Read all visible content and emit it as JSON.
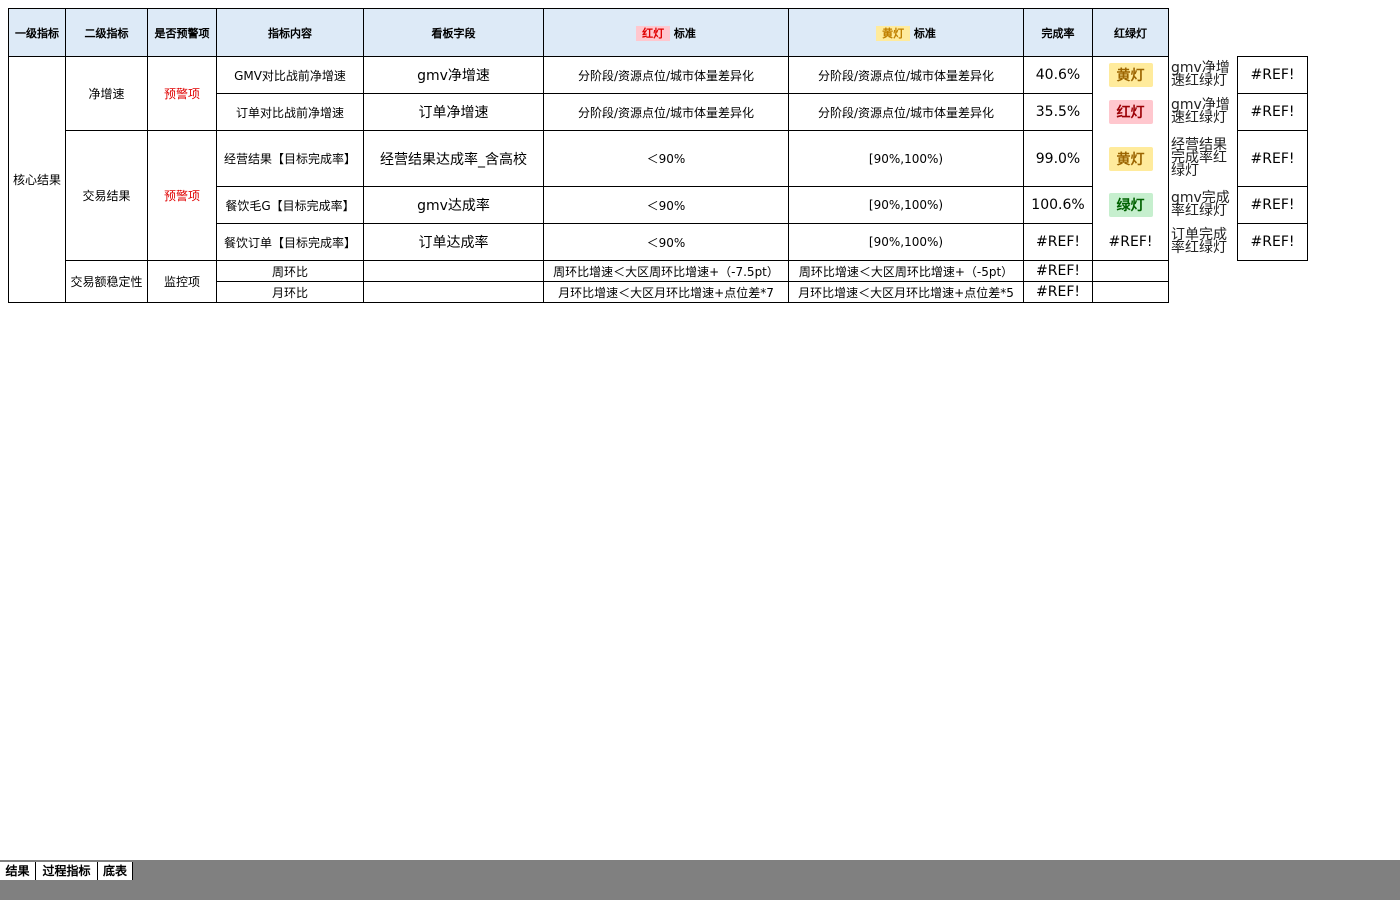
{
  "headers": {
    "level1": "一级指标",
    "level2": "二级指标",
    "is_warning": "是否预警项",
    "content": "指标内容",
    "field": "看板字段",
    "red_lamp": "红灯",
    "red_std": "标准",
    "yellow_lamp": "黄灯",
    "yellow_std": "标准",
    "rate": "完成率",
    "light": "红绿灯"
  },
  "rows": {
    "core": "核心结果",
    "net_growth": "净增速",
    "warn1": "预警项",
    "r1": {
      "content": "GMV对比战前净增速",
      "field": "gmv净增速",
      "red": "分阶段/资源点位/城市体量差异化",
      "yellow": "分阶段/资源点位/城市体量差异化",
      "rate": "40.6%",
      "light": "黄灯",
      "side": "gmv净增速红绿灯",
      "ref": "#REF!"
    },
    "r2": {
      "content": "订单对比战前净增速",
      "field": "订单净增速",
      "red": "分阶段/资源点位/城市体量差异化",
      "yellow": "分阶段/资源点位/城市体量差异化",
      "rate": "35.5%",
      "light": "红灯",
      "side": "gmv净增速红绿灯",
      "ref": "#REF!"
    },
    "trade": "交易结果",
    "warn2": "预警项",
    "r3": {
      "content": "经营结果【目标完成率】",
      "field": "经营结果达成率_含高校",
      "red": "＜90%",
      "yellow": "[90%,100%)",
      "rate": "99.0%",
      "light": "黄灯",
      "side": "经营结果完成率红绿灯",
      "ref": "#REF!"
    },
    "r4": {
      "content": "餐饮毛G【目标完成率】",
      "field": "gmv达成率",
      "red": "＜90%",
      "yellow": "[90%,100%)",
      "rate": "100.6%",
      "light": "绿灯",
      "side": "gmv完成率红绿灯",
      "ref": "#REF!"
    },
    "r5": {
      "content": "餐饮订单【目标完成率】",
      "field": "订单达成率",
      "red": "＜90%",
      "yellow": "[90%,100%)",
      "rate": "#REF!",
      "light": "#REF!",
      "side": "订单完成率红绿灯",
      "ref": "#REF!"
    },
    "stability": "交易额稳定性",
    "monitor": "监控项",
    "r6": {
      "content": "周环比",
      "field": "",
      "red": "周环比增速＜大区周环比增速+（-7.5pt）",
      "yellow": "周环比增速＜大区周环比增速+（-5pt）",
      "rate": "#REF!"
    },
    "r7": {
      "content": "月环比",
      "field": "",
      "red": "月环比增速＜大区月环比增速+点位差*7",
      "yellow": "月环比增速＜大区月环比增速+点位差*5",
      "rate": "#REF!"
    }
  },
  "tabs": [
    "结果",
    "过程指标",
    "底表"
  ],
  "colors": {
    "header_bg": "#ddeaf7",
    "warning_text": "#e00000",
    "tab_bar": "#808080"
  }
}
